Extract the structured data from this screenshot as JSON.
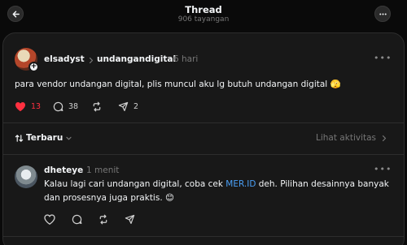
{
  "header": {
    "title": "Thread",
    "views": "906 tayangan",
    "back_icon": "arrow-left-icon",
    "menu_icon": "more-horizontal-icon"
  },
  "post": {
    "username": "elsadyst",
    "reply_to": "undangandigital",
    "time": "6 hari",
    "text": "para vendor undangan digital, plis muncul aku lg butuh undangan digital 🫣",
    "likes": "13",
    "comments": "38",
    "shares": "2",
    "liked": true
  },
  "sort": {
    "label": "Terbaru",
    "activity_label": "Lihat aktivitas"
  },
  "reply": {
    "username": "dheteye",
    "time": "1 menit",
    "text_before_link": "Kalau lagi cari undangan digital, coba cek ",
    "link_text": "MER.ID",
    "text_after_link": " deh. Pilihan desainnya banyak dan prosesnya juga praktis. 😊"
  },
  "colors": {
    "background": "#0a0a0a",
    "card": "#181818",
    "like_red": "#ff3040",
    "link_blue": "#4a9ff5",
    "muted": "#777777"
  }
}
